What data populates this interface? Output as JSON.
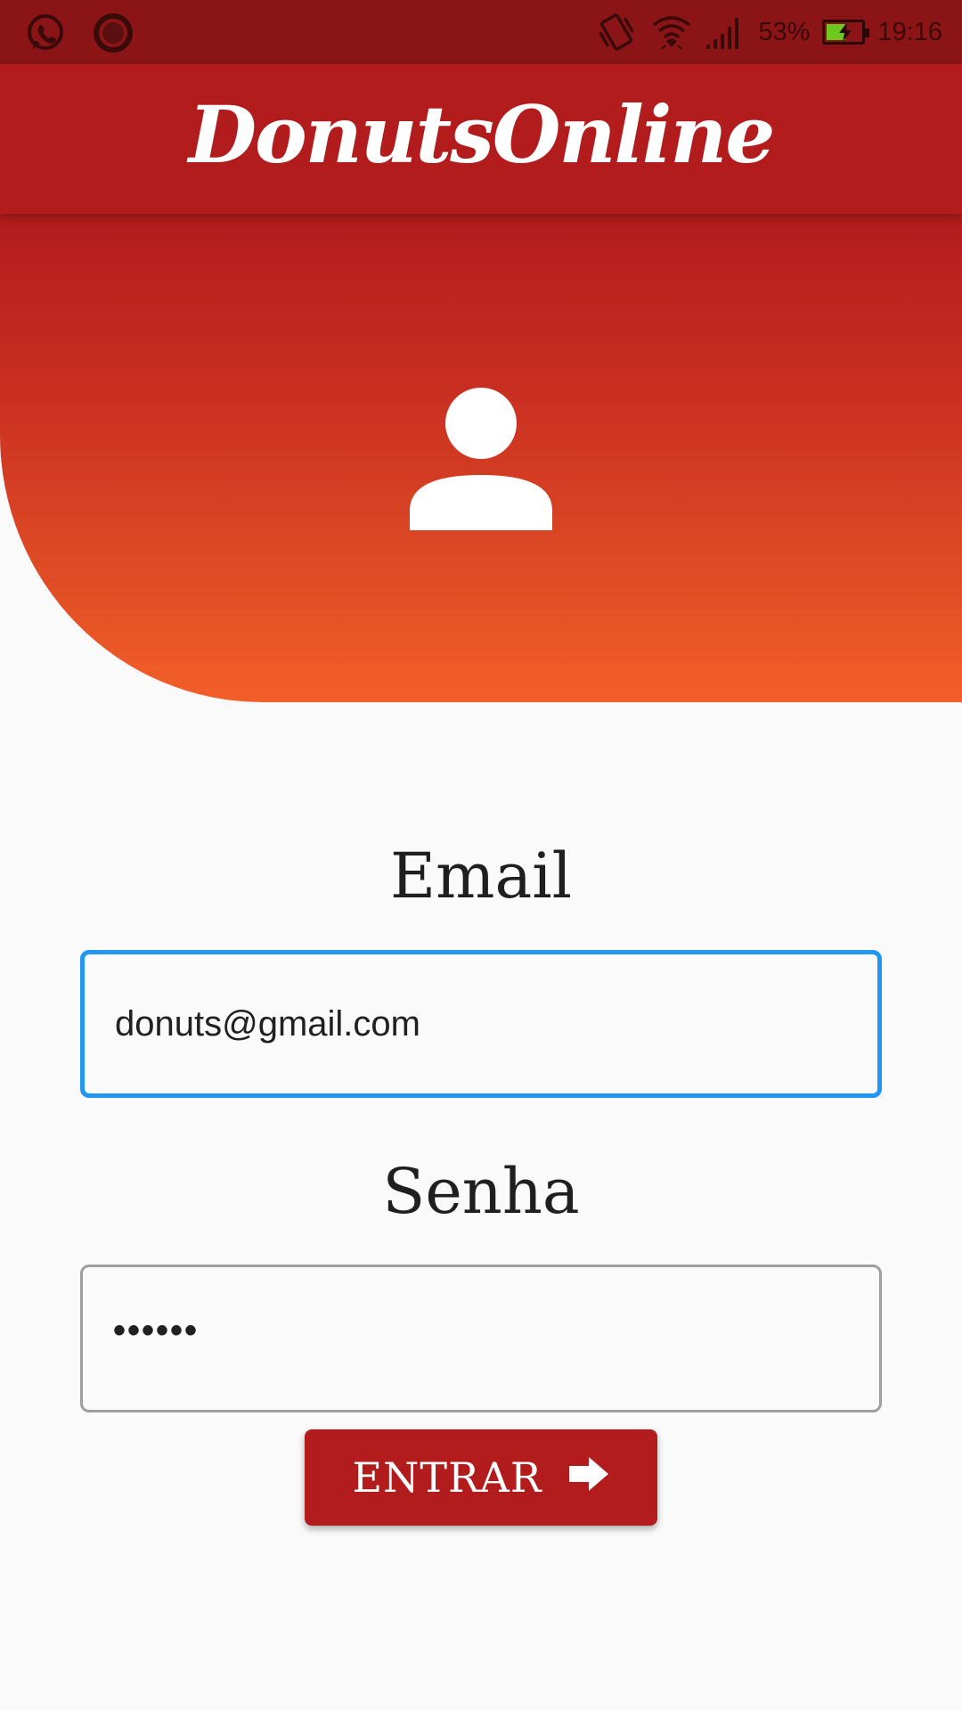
{
  "status_bar": {
    "left_icons": [
      "whatsapp-icon",
      "record-icon"
    ],
    "right_icons": [
      "vibrate-icon",
      "wifi-icon",
      "signal-icon",
      "battery-charging-icon"
    ],
    "battery_percent": "53%",
    "battery_level": 0.53,
    "time": "19:16"
  },
  "app_bar": {
    "title": "DonutsOnline"
  },
  "hero": {
    "icon": "person-icon",
    "gradient_colors": [
      "#b21c1d",
      "#f35f29"
    ]
  },
  "form": {
    "email_label": "Email",
    "email_value": "donuts@gmail.com",
    "password_label": "Senha",
    "password_value": "••••••",
    "submit_label": "ENTRAR",
    "submit_icon": "arrow-right-icon"
  },
  "colors": {
    "primary": "#b21c1d",
    "accent_focus": "#2196f3",
    "status_bar": "#8b1516",
    "battery_fill": "#6dc91c"
  }
}
